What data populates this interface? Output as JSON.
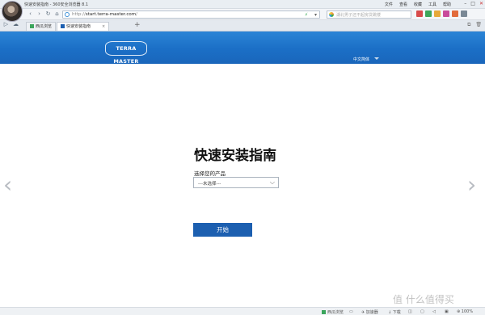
{
  "browser": {
    "window_title": "快速安装指南 - 360安全浏览器 8.1",
    "menu": [
      "文件",
      "查看",
      "收藏",
      "工具",
      "帮助"
    ],
    "url_prefix": "http://",
    "url_host": "start.terra-master.com",
    "url_suffix": "/",
    "search_placeholder": "湖北男子还不起房贷跳楼",
    "tabs": [
      {
        "label": "西瓜浏览"
      },
      {
        "label": "快速安装指南"
      }
    ],
    "new_tab": "+"
  },
  "site": {
    "logo_text": "TERRA MASTER",
    "language": "中文简体"
  },
  "main": {
    "title": "快速安装指南",
    "product_label": "选择您的产品",
    "select_value": "---未选择---",
    "start_button": "开始"
  },
  "statusbar": {
    "left_item": "西瓜浏览",
    "accelerator": "加速器",
    "download": "下载",
    "zoom": "100%"
  },
  "watermark": "值 什么值得买",
  "colors": {
    "header_blue": "#1b6fc6",
    "button_blue": "#1c5fb0",
    "arrow_gray": "#b8bcc2"
  }
}
